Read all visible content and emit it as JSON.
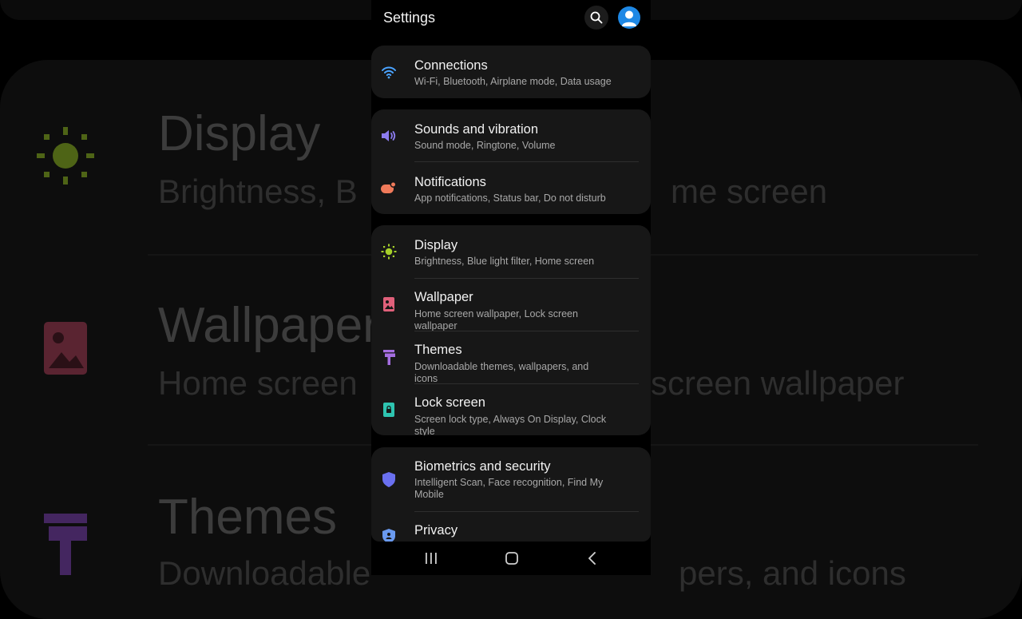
{
  "app": {
    "title": "Settings"
  },
  "colors": {
    "accent": "#1e88e5",
    "wifi": "#4aa3ff",
    "sound": "#8c7cf0",
    "notifications": "#f07a5a",
    "display": "#a6d02a",
    "wallpaper": "#e0607a",
    "themes": "#a56ee0",
    "lock": "#2ec4b0",
    "security": "#6a70f0"
  },
  "background": {
    "items": [
      {
        "title": "Display",
        "sub_left": "Brightness, B",
        "sub_right": "me screen"
      },
      {
        "title": "Wallpaper",
        "sub_left": "Home screen",
        "sub_right": "screen wallpaper"
      },
      {
        "title": "Themes",
        "sub_left": "Downloadable",
        "sub_right": "pers, and icons"
      }
    ]
  },
  "settings": [
    {
      "id": "connections",
      "icon": "wifi-icon",
      "title": "Connections",
      "subtitle": "Wi-Fi, Bluetooth, Airplane mode, Data usage"
    },
    {
      "id": "sounds",
      "icon": "volume-icon",
      "title": "Sounds and vibration",
      "subtitle": "Sound mode, Ringtone, Volume"
    },
    {
      "id": "notifications",
      "icon": "notification-icon",
      "title": "Notifications",
      "subtitle": "App notifications, Status bar, Do not disturb"
    },
    {
      "id": "display",
      "icon": "sun-icon",
      "title": "Display",
      "subtitle": "Brightness, Blue light filter, Home screen"
    },
    {
      "id": "wallpaper",
      "icon": "picture-icon",
      "title": "Wallpaper",
      "subtitle": "Home screen wallpaper, Lock screen wallpaper"
    },
    {
      "id": "themes",
      "icon": "brush-icon",
      "title": "Themes",
      "subtitle": "Downloadable themes, wallpapers, and icons"
    },
    {
      "id": "lockscreen",
      "icon": "lock-icon",
      "title": "Lock screen",
      "subtitle": "Screen lock type, Always On Display, Clock style"
    },
    {
      "id": "biometrics",
      "icon": "shield-icon",
      "title": "Biometrics and security",
      "subtitle": "Intelligent Scan, Face recognition, Find My Mobile"
    },
    {
      "id": "privacy",
      "icon": "privacy-icon",
      "title": "Privacy",
      "subtitle": ""
    }
  ],
  "navbar": {
    "recents_icon": "recents-icon",
    "home_icon": "home-icon",
    "back_icon": "back-icon"
  }
}
